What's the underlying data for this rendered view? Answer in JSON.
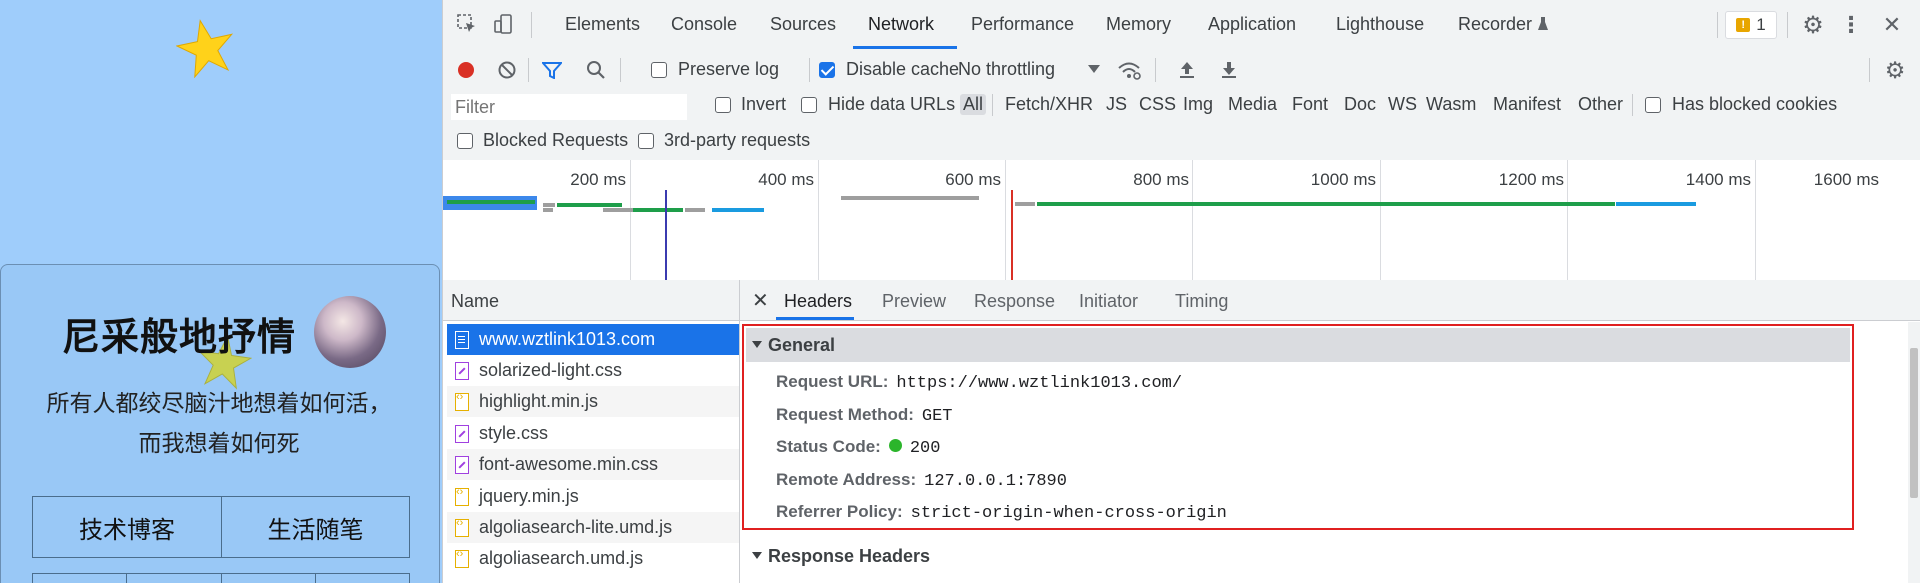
{
  "page": {
    "title": "尼采般地抒情",
    "motto_line1": "所有人都绞尽脑汁地想着如何活，",
    "motto_line2": "而我想着如何死",
    "nav": [
      "技术博客",
      "生活随笔"
    ]
  },
  "devtools": {
    "tabs": [
      "Elements",
      "Console",
      "Sources",
      "Network",
      "Performance",
      "Memory",
      "Application",
      "Lighthouse",
      "Recorder"
    ],
    "active_tab": "Network",
    "issues_count": "1",
    "network_toolbar": {
      "preserve_log": "Preserve log",
      "preserve_log_checked": false,
      "disable_cache": "Disable cache",
      "disable_cache_checked": true,
      "throttling": "No throttling"
    },
    "filter": {
      "placeholder": "Filter",
      "invert": "Invert",
      "hide_data_urls": "Hide data URLs",
      "types": [
        "All",
        "Fetch/XHR",
        "JS",
        "CSS",
        "Img",
        "Media",
        "Font",
        "Doc",
        "WS",
        "Wasm",
        "Manifest",
        "Other"
      ],
      "active_type": "All",
      "has_blocked_cookies": "Has blocked cookies",
      "blocked_requests": "Blocked Requests",
      "third_party": "3rd-party requests"
    },
    "overview_ticks": [
      "200 ms",
      "400 ms",
      "600 ms",
      "800 ms",
      "1000 ms",
      "1200 ms",
      "1400 ms",
      "1600 ms"
    ],
    "requests": {
      "header": "Name",
      "items": [
        {
          "name": "www.wztlink1013.com",
          "type": "doc"
        },
        {
          "name": "solarized-light.css",
          "type": "css"
        },
        {
          "name": "highlight.min.js",
          "type": "js"
        },
        {
          "name": "style.css",
          "type": "css"
        },
        {
          "name": "font-awesome.min.css",
          "type": "css"
        },
        {
          "name": "jquery.min.js",
          "type": "js"
        },
        {
          "name": "algoliasearch-lite.umd.js",
          "type": "js"
        },
        {
          "name": "algoliasearch.umd.js",
          "type": "js"
        }
      ],
      "selected": "www.wztlink1013.com"
    },
    "detail_tabs": [
      "Headers",
      "Preview",
      "Response",
      "Initiator",
      "Timing"
    ],
    "active_detail_tab": "Headers",
    "general": {
      "title": "General",
      "request_url_label": "Request URL:",
      "request_url": "https://www.wztlink1013.com/",
      "request_method_label": "Request Method:",
      "request_method": "GET",
      "status_code_label": "Status Code:",
      "status_code": "200",
      "remote_address_label": "Remote Address:",
      "remote_address": "127.0.0.1:7890",
      "referrer_policy_label": "Referrer Policy:",
      "referrer_policy": "strict-origin-when-cross-origin"
    },
    "response_headers_title": "Response Headers"
  },
  "colors": {
    "page_bg": "#9fcdfb",
    "accent": "#1a73e8",
    "highlight_box": "#e02020",
    "status_ok": "#2bb52b"
  }
}
